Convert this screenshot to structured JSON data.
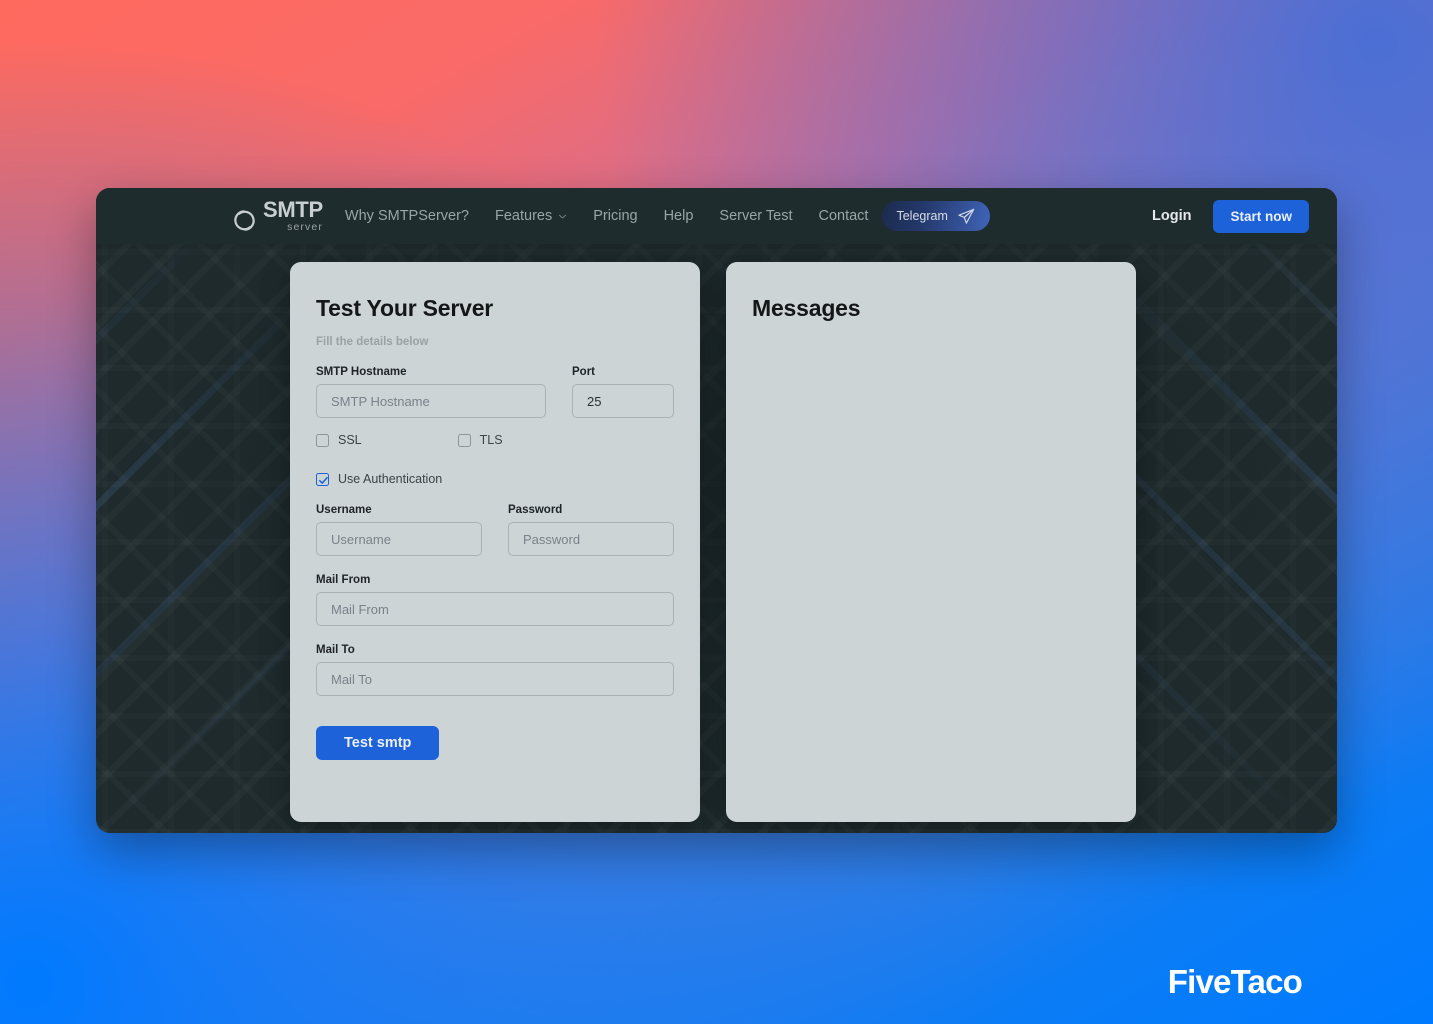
{
  "brand": {
    "logo_main": "SMTP",
    "logo_sub": "server",
    "logo_icon": "smtp-swirl-icon"
  },
  "navbar": {
    "links": [
      {
        "label": "Why SMTPServer?",
        "has_chevron": false
      },
      {
        "label": "Features",
        "has_chevron": true
      },
      {
        "label": "Pricing",
        "has_chevron": false
      },
      {
        "label": "Help",
        "has_chevron": false
      },
      {
        "label": "Server Test",
        "has_chevron": false
      },
      {
        "label": "Contact",
        "has_chevron": false
      }
    ],
    "telegram_label": "Telegram",
    "telegram_icon": "paper-plane-icon",
    "login_label": "Login",
    "start_label": "Start now"
  },
  "form_card": {
    "title": "Test Your Server",
    "subtitle": "Fill the details below",
    "hostname_label": "SMTP Hostname",
    "hostname_placeholder": "SMTP Hostname",
    "hostname_value": "",
    "port_label": "Port",
    "port_value": "25",
    "ssl_label": "SSL",
    "ssl_checked": false,
    "tls_label": "TLS",
    "tls_checked": false,
    "auth_label": "Use Authentication",
    "auth_checked": true,
    "username_label": "Username",
    "username_placeholder": "Username",
    "username_value": "",
    "password_label": "Password",
    "password_placeholder": "Password",
    "password_value": "",
    "mail_from_label": "Mail From",
    "mail_from_placeholder": "Mail From",
    "mail_from_value": "",
    "mail_to_label": "Mail To",
    "mail_to_placeholder": "Mail To",
    "mail_to_value": "",
    "submit_label": "Test smtp"
  },
  "messages_card": {
    "title": "Messages",
    "body": ""
  },
  "watermark": {
    "label": "FiveTaco"
  },
  "colors": {
    "accent_blue": "#1d62d8",
    "navbar_bg": "#1f2c2e",
    "card_bg": "#ccd4d5",
    "page_dark": "#1e2a2c",
    "backdrop_coral": "#ff6a5e",
    "backdrop_blue": "#007bff"
  }
}
